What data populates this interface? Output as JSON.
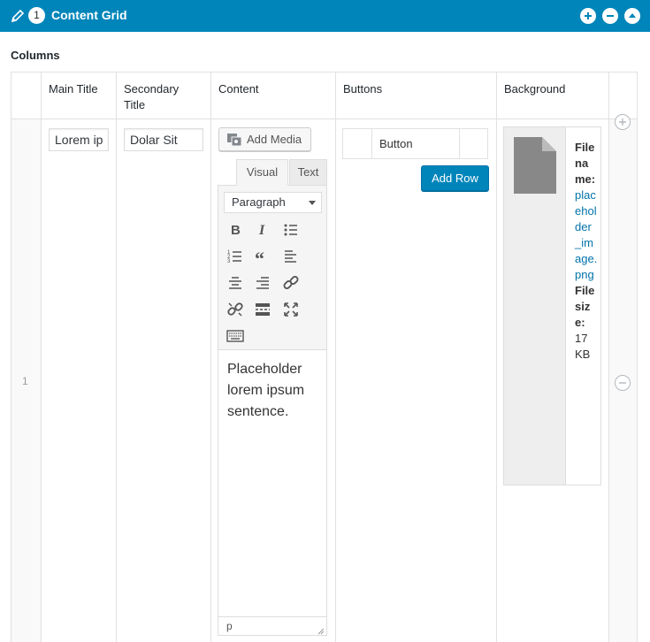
{
  "header": {
    "row_number": "1",
    "title": "Content Grid"
  },
  "section": {
    "label": "Columns"
  },
  "columns": {
    "main_title": "Main Title",
    "secondary_title": "Secondary Title",
    "content": "Content",
    "buttons": "Buttons",
    "background": "Background"
  },
  "row": {
    "index": "1",
    "main_title_value": "Lorem ip",
    "secondary_title_value": "Dolar Sit",
    "add_media_label": "Add Media",
    "tab_visual": "Visual",
    "tab_text": "Text",
    "format_select": "Paragraph",
    "editor_content": "Placeholder lorem ipsum sentence.",
    "status_path": "p",
    "button_cell": "Button",
    "add_row_label": "Add Row",
    "file_name_label": "File name:",
    "file_name_value": "placeholder_image.png",
    "file_size_label": "File size:",
    "file_size_value": "17 KB"
  },
  "colors": {
    "header_bg": "#0085ba",
    "primary_button": "#0085ba",
    "link": "#0073aa"
  },
  "icons": [
    "pencil-icon",
    "add-icon",
    "remove-icon",
    "collapse-icon",
    "bold-icon",
    "italic-icon",
    "bullet-list-icon",
    "numbered-list-icon",
    "blockquote-icon",
    "align-left-icon",
    "align-center-icon",
    "align-right-icon",
    "link-icon",
    "unlink-icon",
    "read-more-icon",
    "fullscreen-icon",
    "keyboard-icon",
    "file-icon",
    "resize-handle-icon"
  ]
}
